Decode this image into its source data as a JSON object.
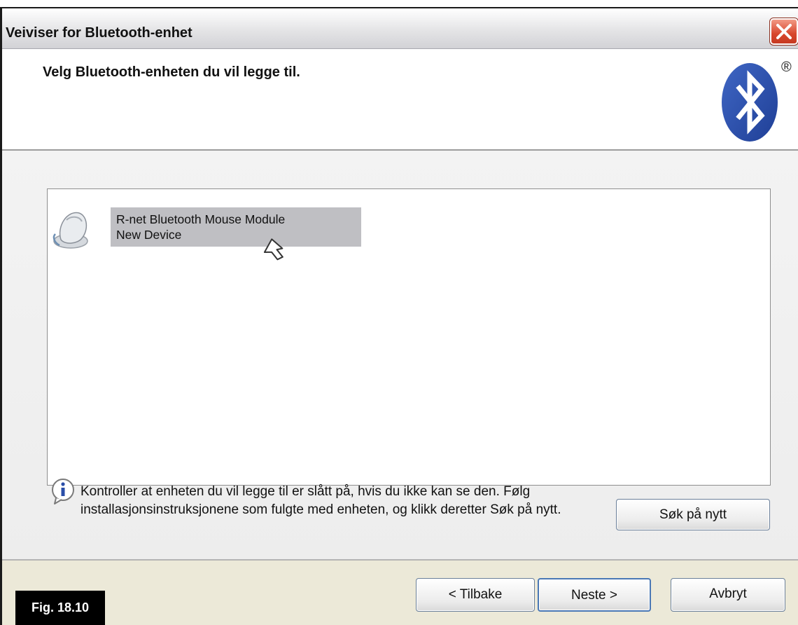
{
  "window": {
    "title": "Veiviser for Bluetooth-enhet"
  },
  "header": {
    "title": "Velg Bluetooth-enheten du vil legge til.",
    "logo_icon": "bluetooth-logo-icon",
    "registered_mark": "®",
    "accent_color": "#2a4ea8"
  },
  "device_list": {
    "items": [
      {
        "name": "R-net Bluetooth Mouse Module",
        "status": "New Device",
        "icon": "mouse-device-icon",
        "selected": true
      }
    ]
  },
  "info": {
    "icon": "info-icon",
    "text": "Kontroller at enheten du vil legge til er slått på, hvis du ikke kan se den. Følg installasjonsinstruksjonene som fulgte med enheten, og klikk deretter Søk på nytt."
  },
  "buttons": {
    "search_again": "Søk på nytt",
    "back": "< Tilbake",
    "next": "Neste >",
    "cancel": "Avbryt"
  },
  "figure_label": "Fig. 18.10"
}
